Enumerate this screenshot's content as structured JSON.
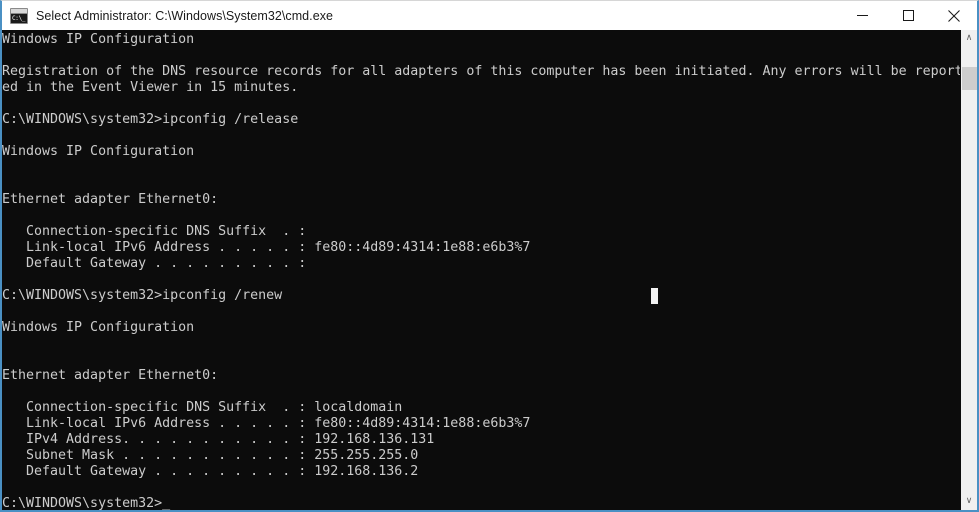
{
  "window": {
    "title": "Select Administrator: C:\\Windows\\System32\\cmd.exe",
    "icon_label": "C:\\_",
    "accent_border_color": "#4a90c4",
    "titlebar_bg": "#ffffff",
    "console_bg": "#0c0c0c",
    "console_fg": "#cccccc"
  },
  "controls": {
    "minimize_label": "Minimize",
    "maximize_label": "Maximize",
    "close_label": "Close"
  },
  "scrollbar": {
    "up_arrow": "∧",
    "down_arrow": "∨",
    "thumb_position_pct": 4
  },
  "console": {
    "cursor_block_visible": true,
    "prompt": "C:\\WINDOWS\\system32>",
    "commands": [
      "ipconfig /release",
      "ipconfig /renew"
    ],
    "lines": [
      "Windows IP Configuration",
      "",
      "Registration of the DNS resource records for all adapters of this computer has been initiated. Any errors will be report",
      "ed in the Event Viewer in 15 minutes.",
      "",
      "C:\\WINDOWS\\system32>ipconfig /release",
      "",
      "Windows IP Configuration",
      "",
      "",
      "Ethernet adapter Ethernet0:",
      "",
      "   Connection-specific DNS Suffix  . :",
      "   Link-local IPv6 Address . . . . . : fe80::4d89:4314:1e88:e6b3%7",
      "   Default Gateway . . . . . . . . . :",
      "",
      "C:\\WINDOWS\\system32>ipconfig /renew",
      "",
      "Windows IP Configuration",
      "",
      "",
      "Ethernet adapter Ethernet0:",
      "",
      "   Connection-specific DNS Suffix  . : localdomain",
      "   Link-local IPv6 Address . . . . . : fe80::4d89:4314:1e88:e6b3%7",
      "   IPv4 Address. . . . . . . . . . . : 192.168.136.131",
      "   Subnet Mask . . . . . . . . . . . : 255.255.255.0",
      "   Default Gateway . . . . . . . . . : 192.168.136.2",
      "",
      "C:\\WINDOWS\\system32>_"
    ],
    "network_values": {
      "adapter_name": "Ethernet adapter Ethernet0:",
      "dns_suffix": "localdomain",
      "ipv6_link_local": "fe80::4d89:4314:1e88:e6b3%7",
      "ipv4_address": "192.168.136.131",
      "subnet_mask": "255.255.255.0",
      "default_gateway": "192.168.136.2"
    }
  }
}
